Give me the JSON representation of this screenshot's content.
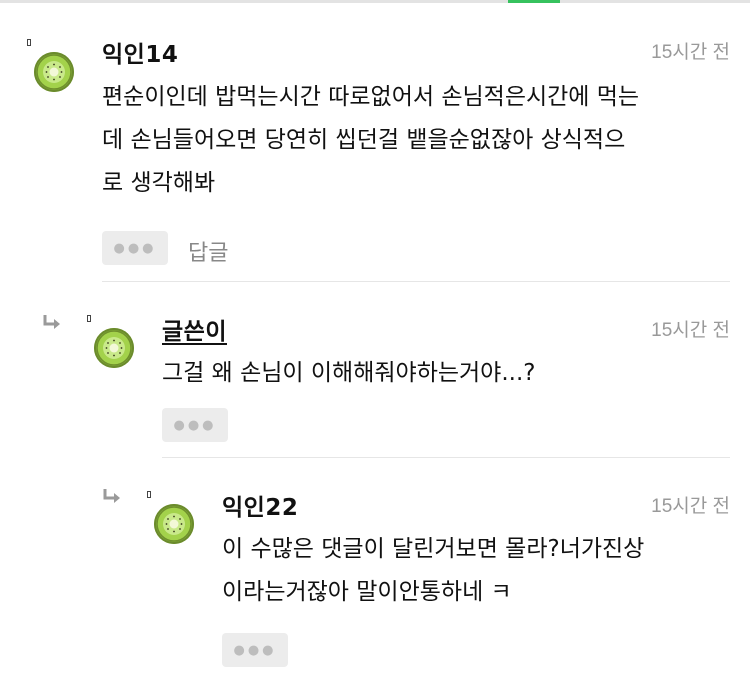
{
  "comments": [
    {
      "author": "익인14",
      "time": "15시간 전",
      "lines": [
        "편순이인데 밥먹는시간 따로없어서 손님적은시간에 먹는",
        "데 손님들어오면 당연히 씹던걸 뱉을순없잖아 상식적으",
        "로 생각해봐"
      ],
      "more_label": "●●●",
      "reply_label": "답글"
    },
    {
      "author": "글쓴이",
      "time": "15시간 전",
      "lines": [
        "그걸 왜 손님이 이해해줘야하는거야...?"
      ],
      "more_label": "●●●"
    },
    {
      "author": "익인22",
      "time": "15시간 전",
      "lines": [
        "이 수많은 댓글이 달린거보면 몰라?너가진상",
        "이라는거잖아 말이안통하네 ㅋ"
      ],
      "more_label": "●●●"
    }
  ],
  "colors": {
    "accent": "#36c25e",
    "avatar": "#8bbf3f",
    "time": "#999999",
    "button_bg": "#ececec"
  },
  "icons": {
    "avatar": "kiwi-icon",
    "reply_indicator": "reply-arrow-icon"
  }
}
